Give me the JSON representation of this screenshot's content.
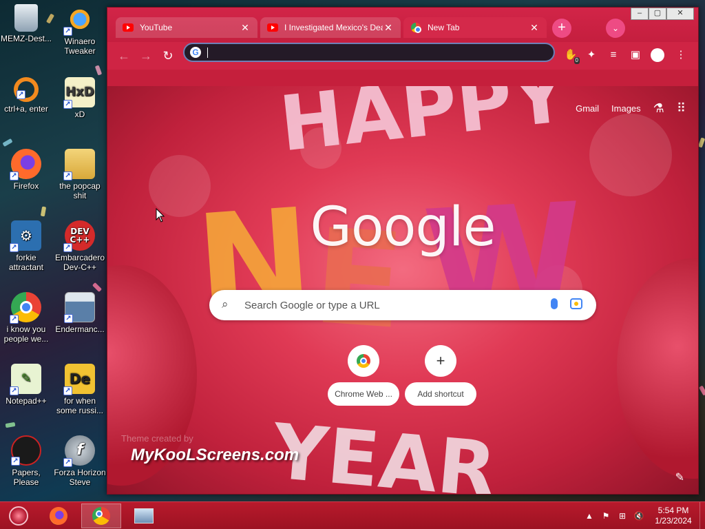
{
  "desktop": {
    "icons": [
      {
        "label": "MEMZ-Dest...",
        "icon": "recycle-bin-icon"
      },
      {
        "label": "Winaero Tweaker",
        "icon": "winaero-icon"
      },
      {
        "label": "ctrl+a, enter",
        "icon": "orange-ring-icon"
      },
      {
        "label": "xD",
        "icon": "hxd-icon"
      },
      {
        "label": "Firefox",
        "icon": "firefox-icon"
      },
      {
        "label": "the popcap shit",
        "icon": "folder-icon"
      },
      {
        "label": "forkie attractant",
        "icon": "settings-monitor-icon"
      },
      {
        "label": "Embarcadero Dev-C++",
        "icon": "devcpp-icon"
      },
      {
        "label": "i know you people we...",
        "icon": "chrome-icon"
      },
      {
        "label": "Endermanc...",
        "icon": "window-app-icon"
      },
      {
        "label": "Notepad++",
        "icon": "notepadpp-icon"
      },
      {
        "label": "for when some russi...",
        "icon": "de-app-icon"
      },
      {
        "label": "Papers, Please",
        "icon": "papers-please-icon"
      },
      {
        "label": "Forza Horizon Steve",
        "icon": "flash-icon"
      }
    ]
  },
  "browser": {
    "tabs": [
      {
        "title": "YouTube",
        "state": "inactive"
      },
      {
        "title": "I Investigated Mexico's Dea",
        "state": "inactive"
      },
      {
        "title": "New Tab",
        "state": "active"
      }
    ],
    "new_tab_symbol": "+",
    "tab_search_symbol": "⌄",
    "window_controls": [
      "–",
      "▢",
      "✕"
    ],
    "toolbar": {
      "back": "←",
      "forward": "→",
      "reload": "↻",
      "omnibox_value": "",
      "extension_badge": "0"
    },
    "ntp": {
      "links": {
        "gmail": "Gmail",
        "images": "Images"
      },
      "logo": "Google",
      "search_placeholder": "Search Google or type a URL",
      "shortcuts": [
        {
          "label": "Chrome Web ...",
          "icon": "chrome-web-store-icon"
        },
        {
          "label": "Add shortcut",
          "icon": "plus-icon"
        }
      ],
      "theme_credit": "Theme created by",
      "watermark": "MyKooLScreens.com"
    }
  },
  "taskbar": {
    "apps": [
      "start-orb",
      "firefox",
      "chrome",
      "system-monitor"
    ],
    "tray": {
      "time": "5:54 PM",
      "date": "1/23/2024"
    }
  },
  "colors": {
    "chrome_frame": "#c51f3c",
    "accent_pink": "#ee4b84",
    "taskbar": "#b81a2c"
  }
}
